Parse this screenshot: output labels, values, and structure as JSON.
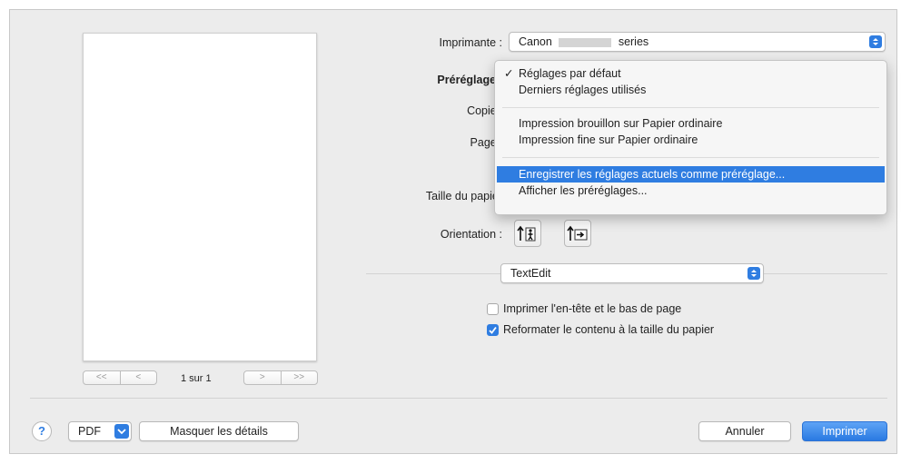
{
  "printer": {
    "label": "Imprimante :",
    "value_prefix": "Canon",
    "value_suffix": "series"
  },
  "presets": {
    "label": "Préréglages"
  },
  "copies": {
    "label": "Copies"
  },
  "pages": {
    "label": "Pages"
  },
  "paper_size": {
    "label": "Taille du papier"
  },
  "orientation": {
    "label": "Orientation :"
  },
  "app_section": {
    "value": "TextEdit"
  },
  "options": [
    {
      "label": "Imprimer l'en-tête et le bas de page",
      "checked": false
    },
    {
      "label": "Reformater le contenu à la taille du papier",
      "checked": true
    }
  ],
  "preview": {
    "page_indicator": "1 sur 1"
  },
  "presets_menu": {
    "items": [
      {
        "label": "Réglages par défaut",
        "checked": true,
        "highlighted": false
      },
      {
        "label": "Derniers réglages utilisés",
        "checked": false,
        "highlighted": false
      },
      {
        "label": "Impression brouillon sur Papier ordinaire",
        "checked": false,
        "highlighted": false
      },
      {
        "label": "Impression fine sur Papier ordinaire",
        "checked": false,
        "highlighted": false
      },
      {
        "label": "Enregistrer les réglages actuels comme préréglage...",
        "checked": false,
        "highlighted": true
      },
      {
        "label": "Afficher les préréglages...",
        "checked": false,
        "highlighted": false
      }
    ]
  },
  "footer": {
    "help": "?",
    "pdf": "PDF",
    "hide_details": "Masquer les détails",
    "cancel": "Annuler",
    "print": "Imprimer"
  },
  "colors": {
    "accent": "#2f7de1",
    "window_bg": "#ececec"
  },
  "icons": [
    "help-icon",
    "popup-arrows-icon",
    "portrait-orientation-icon",
    "landscape-orientation-icon",
    "checkmark-icon",
    "chevron-down-icon"
  ]
}
